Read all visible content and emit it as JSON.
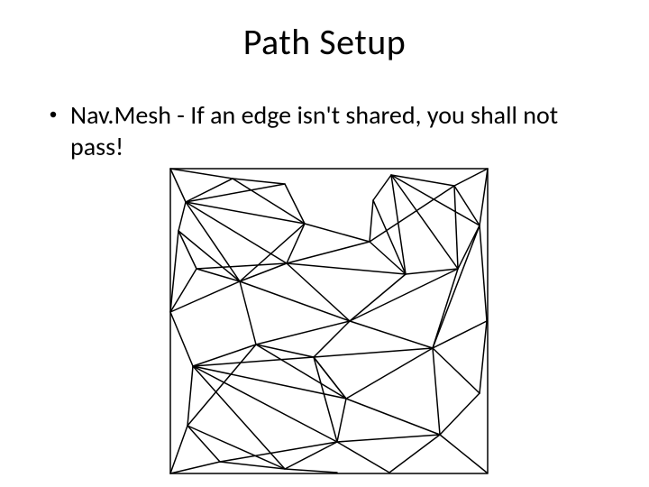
{
  "title": "Path Setup",
  "bullets": [
    {
      "text": "Nav.Mesh - If an edge isn't shared, you shall not pass!"
    }
  ],
  "diagram": {
    "name": "navmesh-diagram",
    "alt": "Triangulated navigation mesh with impassable holes"
  }
}
